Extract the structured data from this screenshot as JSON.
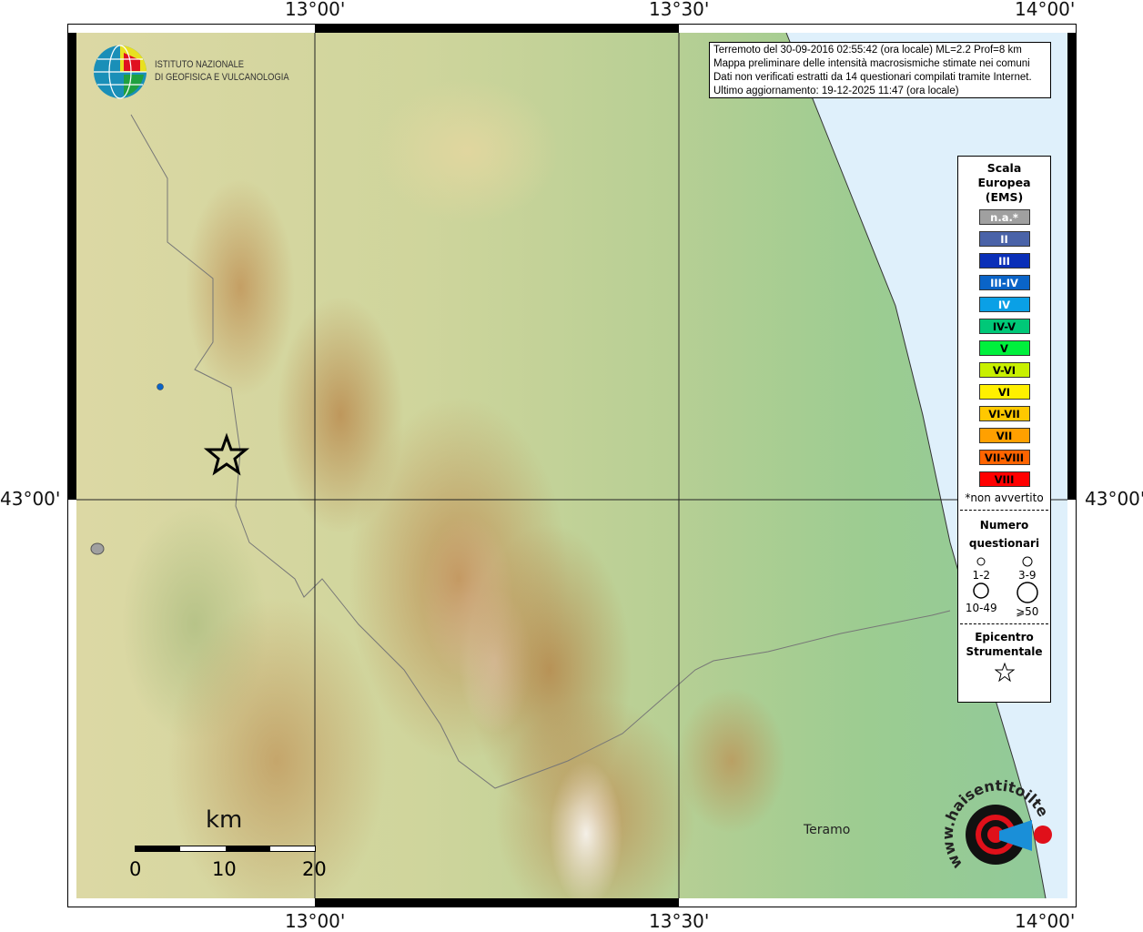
{
  "axes": {
    "lon_ticks": [
      "13°00'",
      "13°30'",
      "14°00'"
    ],
    "lat_ticks": [
      "43°00'"
    ]
  },
  "logo": {
    "line1": "ISTITUTO NAZIONALE",
    "line2": "DI GEOFISICA E VULCANOLOGIA"
  },
  "info": {
    "line1": "Terremoto del 30-09-2016 02:55:42 (ora locale) ML=2.2 Prof=8 km",
    "line2": "Mappa preliminare delle intensità macrosismiche stimate nei comuni",
    "line3": "Dati non verificati estratti da 14 questionari compilati tramite Internet.",
    "line4": "Ultimo aggiornamento: 19-12-2025 11:47 (ora locale)"
  },
  "legend": {
    "title": [
      "Scala",
      "Europea",
      "(EMS)"
    ],
    "classes": [
      {
        "label": "n.a.*",
        "color": "#a0a0a0",
        "text": "#fff"
      },
      {
        "label": "II",
        "color": "#4a63a8",
        "text": "#fff"
      },
      {
        "label": "III",
        "color": "#0a2fb8",
        "text": "#fff"
      },
      {
        "label": "III-IV",
        "color": "#0a64c8",
        "text": "#fff"
      },
      {
        "label": "IV",
        "color": "#0aa0e6",
        "text": "#fff"
      },
      {
        "label": "IV-V",
        "color": "#00c878",
        "text": "#000"
      },
      {
        "label": "V",
        "color": "#00f03c",
        "text": "#000"
      },
      {
        "label": "V-VI",
        "color": "#c8f000",
        "text": "#000"
      },
      {
        "label": "VI",
        "color": "#fff000",
        "text": "#000"
      },
      {
        "label": "VI-VII",
        "color": "#ffc800",
        "text": "#000"
      },
      {
        "label": "VII",
        "color": "#ffa000",
        "text": "#000"
      },
      {
        "label": "VII-VIII",
        "color": "#ff6400",
        "text": "#000"
      },
      {
        "label": "VIII",
        "color": "#ff0000",
        "text": "#000"
      }
    ],
    "note": "*non avvertito",
    "count_title": [
      "Numero",
      "questionari"
    ],
    "counts": [
      "1-2",
      "3-9",
      "10-49",
      "⩾50"
    ],
    "epicenter_title": [
      "Epicentro",
      "Strumentale"
    ]
  },
  "places": {
    "teramo": "Teramo"
  },
  "scale": {
    "unit": "km",
    "labels": [
      "0",
      "10",
      "20"
    ]
  },
  "brand": {
    "text": "www.haisentitoilterremoto.it"
  },
  "points": [
    {
      "intensity": "III-IV",
      "count": "1-2"
    },
    {
      "intensity": "n.a.*",
      "count": "3-9"
    }
  ]
}
